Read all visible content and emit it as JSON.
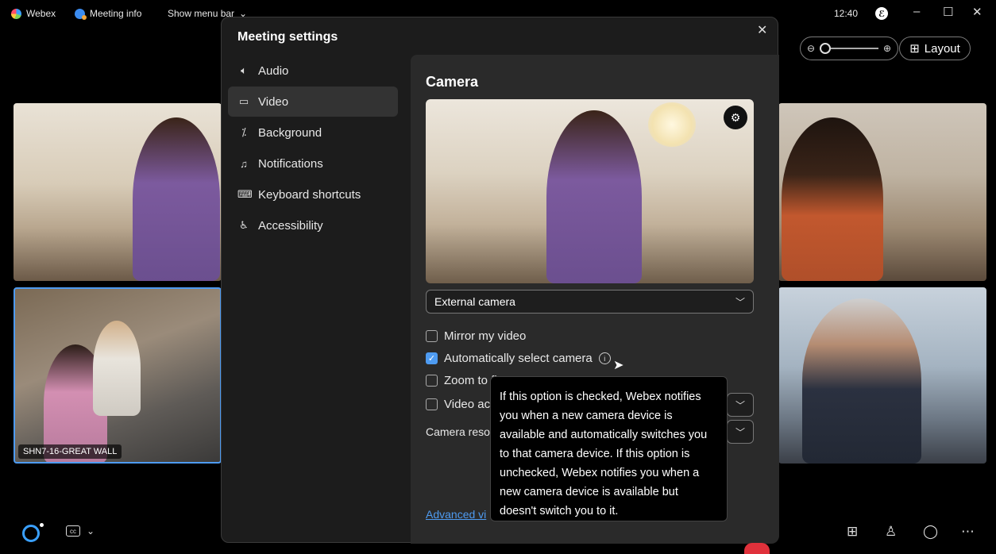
{
  "topbar": {
    "app_name": "Webex",
    "meeting_info": "Meeting info",
    "show_menu_bar": "Show menu bar",
    "time": "12:40"
  },
  "controls": {
    "layout_label": "Layout"
  },
  "tiles": {
    "room_name": "SHN7-16-GREAT WALL"
  },
  "dialog": {
    "title": "Meeting settings",
    "nav": [
      {
        "label": "Audio",
        "icon": "speaker-icon"
      },
      {
        "label": "Video",
        "icon": "camera-icon"
      },
      {
        "label": "Background",
        "icon": "magic-wand-icon"
      },
      {
        "label": "Notifications",
        "icon": "bell-icon"
      },
      {
        "label": "Keyboard shortcuts",
        "icon": "keyboard-icon"
      },
      {
        "label": "Accessibility",
        "icon": "accessibility-icon"
      }
    ],
    "active_nav": "Video",
    "panel": {
      "title": "Camera",
      "camera_select": "External camera",
      "mirror_label": "Mirror my video",
      "mirror_checked": false,
      "auto_select_label": "Automatically select camera",
      "auto_select_checked": true,
      "zoom_label": "Zoom to fit",
      "zoom_checked": false,
      "video_label": "Video ac",
      "video_checked": false,
      "resolution_label": "Camera reso",
      "advanced_link": "Advanced vi"
    },
    "tooltip": "If this option is checked, Webex notifies you when a new camera device is available and automatically switches you to that camera device. If this option is unchecked, Webex notifies you when a new camera device is available but doesn't switch you to it."
  },
  "colors": {
    "accent": "#4e9bf1",
    "hangup": "#e0313b",
    "dialog_bg": "#1c1c1c",
    "panel_bg": "#2a2a2a"
  }
}
